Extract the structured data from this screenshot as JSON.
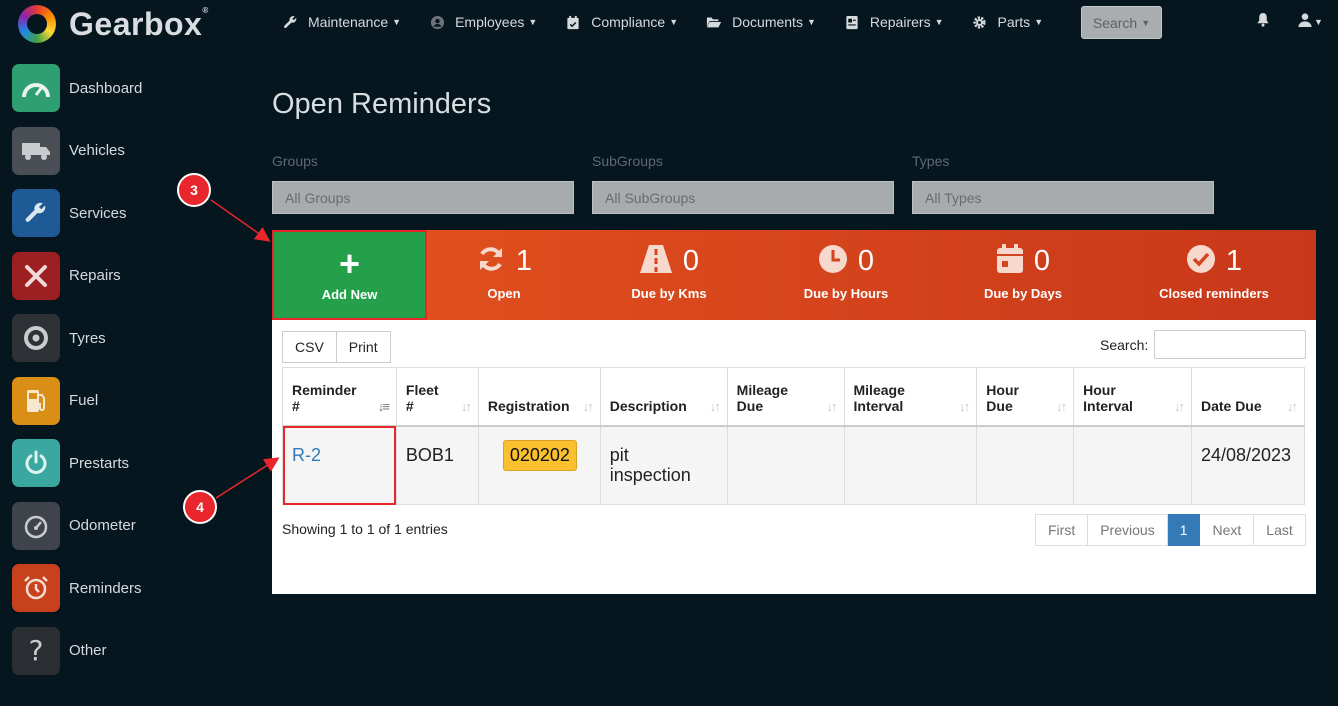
{
  "app": {
    "name": "Gearbox"
  },
  "colors": {
    "accent_orange": "#e4531e",
    "add_green": "#24a04a",
    "annotation_red": "#e8262b",
    "link_blue": "#337ab7",
    "badge_yellow": "#fbc02d"
  },
  "topnav": {
    "items": [
      {
        "label": "Maintenance",
        "icon": "wrench-icon"
      },
      {
        "label": "Employees",
        "icon": "user-circle-icon"
      },
      {
        "label": "Compliance",
        "icon": "calendar-check-icon"
      },
      {
        "label": "Documents",
        "icon": "folder-open-icon"
      },
      {
        "label": "Repairers",
        "icon": "id-card-icon"
      },
      {
        "label": "Parts",
        "icon": "gear-icon"
      }
    ],
    "search_label": "Search"
  },
  "sidebar": {
    "items": [
      {
        "label": "Dashboard",
        "icon": "gauge-icon",
        "color": "#2f9e72"
      },
      {
        "label": "Vehicles",
        "icon": "truck-icon",
        "color": "#4a4f55"
      },
      {
        "label": "Services",
        "icon": "wrench-icon",
        "color": "#1d5a96"
      },
      {
        "label": "Repairs",
        "icon": "tools-icon",
        "color": "#9c1f22"
      },
      {
        "label": "Tyres",
        "icon": "tyre-icon",
        "color": "#2e3237"
      },
      {
        "label": "Fuel",
        "icon": "fuel-pump-icon",
        "color": "#d98e16"
      },
      {
        "label": "Prestarts",
        "icon": "power-icon",
        "color": "#3aa8a0"
      },
      {
        "label": "Odometer",
        "icon": "odometer-icon",
        "color": "#3e4449"
      },
      {
        "label": "Reminders",
        "icon": "alarm-clock-icon",
        "color": "#c7411c"
      },
      {
        "label": "Other",
        "icon": "question-icon",
        "color": "#2a2e33"
      }
    ]
  },
  "page": {
    "title": "Open Reminders",
    "filters": [
      {
        "label": "Groups",
        "value": "All Groups"
      },
      {
        "label": "SubGroups",
        "value": "All SubGroups"
      },
      {
        "label": "Types",
        "value": "All Types"
      }
    ]
  },
  "stats": {
    "add_new_label": "Add New",
    "items": [
      {
        "value": "1",
        "label": "Open",
        "icon": "refresh-icon"
      },
      {
        "value": "0",
        "label": "Due by Kms",
        "icon": "road-icon"
      },
      {
        "value": "0",
        "label": "Due by Hours",
        "icon": "clock-icon"
      },
      {
        "value": "0",
        "label": "Due by Days",
        "icon": "calendar-icon"
      },
      {
        "value": "1",
        "label": "Closed reminders",
        "icon": "check-circle-icon"
      }
    ]
  },
  "table": {
    "buttons": [
      "CSV",
      "Print"
    ],
    "search_label": "Search:",
    "columns": [
      {
        "line1": "Reminder",
        "line2": "#"
      },
      {
        "line1": "Fleet",
        "line2": "#"
      },
      {
        "line1": "",
        "line2": "Registration"
      },
      {
        "line1": "",
        "line2": "Description"
      },
      {
        "line1": "Mileage",
        "line2": "Due"
      },
      {
        "line1": "Mileage",
        "line2": "Interval"
      },
      {
        "line1": "Hour",
        "line2": "Due"
      },
      {
        "line1": "Hour",
        "line2": "Interval"
      },
      {
        "line1": "",
        "line2": "Date Due"
      }
    ],
    "rows": [
      {
        "reminder": "R-2",
        "fleet": "BOB1",
        "registration": "020202",
        "description_line1": "pit",
        "description_line2": "inspection",
        "mileage_due": "",
        "mileage_interval": "",
        "hour_due": "",
        "hour_interval": "",
        "date_due": "24/08/2023"
      }
    ],
    "showing_text": "Showing 1 to 1 of 1 entries",
    "pagination": [
      "First",
      "Previous",
      "1",
      "Next",
      "Last"
    ]
  },
  "annotations": [
    {
      "number": "3"
    },
    {
      "number": "4"
    }
  ]
}
